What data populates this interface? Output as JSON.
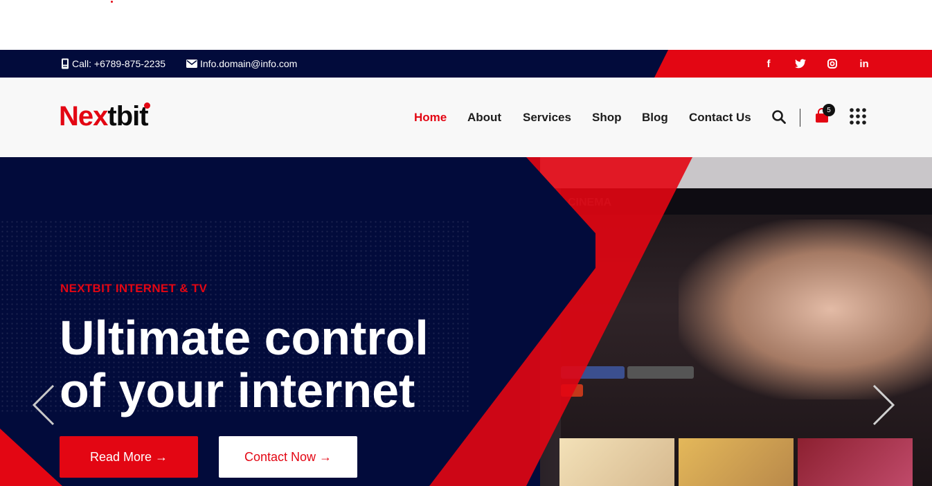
{
  "topbar": {
    "phone": "Call: +6789-875-2235",
    "email": "Info.domain@info.com",
    "social": [
      "facebook-icon",
      "twitter-icon",
      "instagram-icon",
      "linkedin-icon"
    ]
  },
  "header": {
    "logo_part1": "Nex",
    "logo_part2": "tbit",
    "nav": [
      "Home",
      "About",
      "Services",
      "Shop",
      "Blog",
      "Contact Us"
    ],
    "active_nav": "Home",
    "cart_count": "5"
  },
  "hero": {
    "eyebrow": "NEXTBIT INTERNET & TV",
    "headline_line1": "Ultimate control",
    "headline_line2": "of your internet",
    "primary_button": "Read More →",
    "secondary_button": "Contact Now →",
    "tv_brand": "CINEMA"
  },
  "colors": {
    "navy": "#020b3b",
    "red": "#e30613",
    "header_bg": "#f8f8f8"
  }
}
